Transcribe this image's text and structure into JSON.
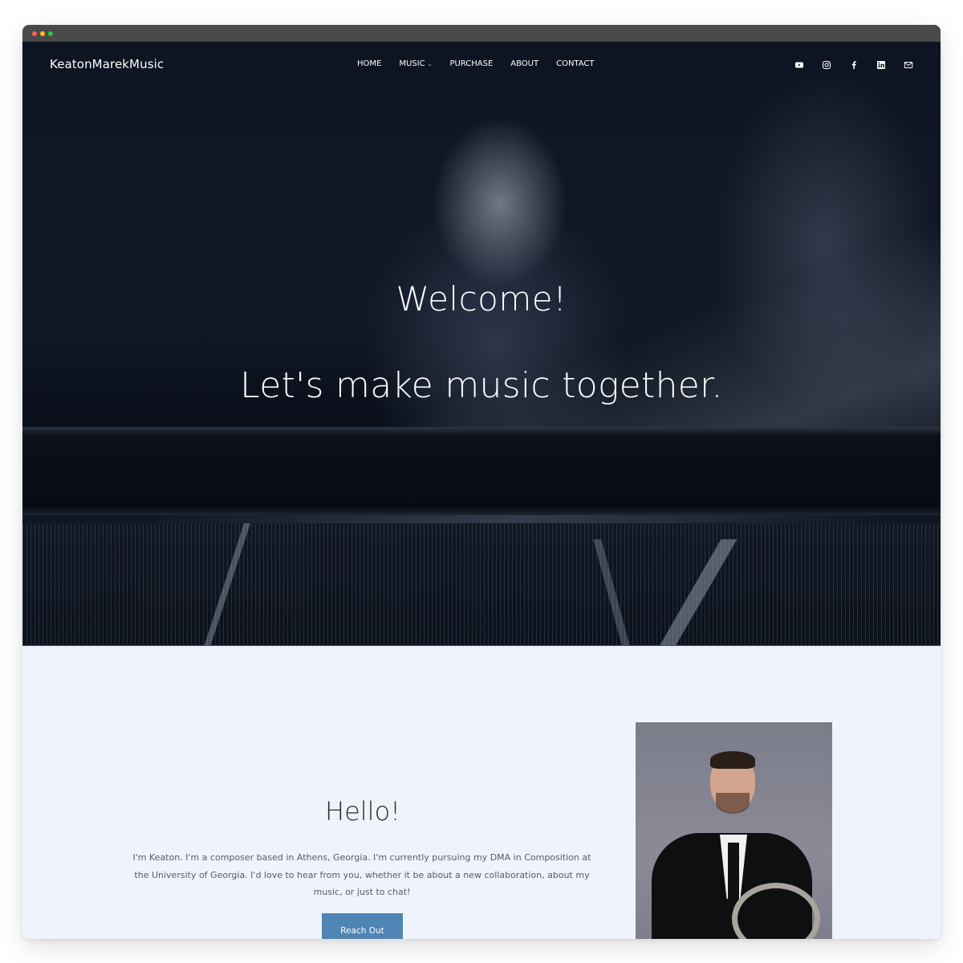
{
  "window": {
    "controls": [
      "close",
      "minimize",
      "maximize"
    ]
  },
  "nav": {
    "brand": "KeatonMarekMusic",
    "items": [
      {
        "label": "HOME",
        "has_dropdown": false
      },
      {
        "label": "MUSIC",
        "has_dropdown": true
      },
      {
        "label": "PURCHASE",
        "has_dropdown": false
      },
      {
        "label": "ABOUT",
        "has_dropdown": false
      },
      {
        "label": "CONTACT",
        "has_dropdown": false
      }
    ],
    "dropdown_icon": "chevron-down-icon",
    "dropdown_glyph": "⌄",
    "social": [
      {
        "name": "youtube",
        "icon": "youtube-icon"
      },
      {
        "name": "instagram",
        "icon": "instagram-icon"
      },
      {
        "name": "facebook",
        "icon": "facebook-icon"
      },
      {
        "name": "linkedin",
        "icon": "linkedin-icon"
      },
      {
        "name": "email",
        "icon": "mail-icon"
      }
    ]
  },
  "hero": {
    "heading": "Welcome!",
    "tagline": "Let's make music together.",
    "image_alt": "Pianist in suit playing a grand piano"
  },
  "about": {
    "heading": "Hello!",
    "bio": "I'm Keaton. I'm a composer based in Athens, Georgia. I'm currently pursuing my DMA in Composition at the University of Georgia. I'd love to hear from you, whether it be about a new collaboration, about my music, or just to chat!",
    "button_label": "Reach Out",
    "portrait_alt": "Keaton smiling, holding a French horn"
  },
  "colors": {
    "hero_bg": "#0d1320",
    "about_bg": "#eff4fc",
    "button_bg": "#4f84b4",
    "heading_text": "#2a2a2a",
    "body_text": "#555b66"
  }
}
